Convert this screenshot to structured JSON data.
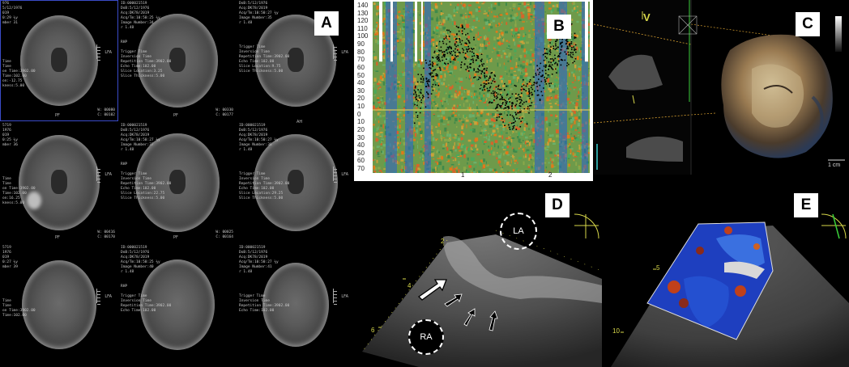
{
  "panels": {
    "a": {
      "badge": "A"
    },
    "b": {
      "badge": "B"
    },
    "c": {
      "badge": "C",
      "scale_label": "1 cm"
    },
    "d": {
      "badge": "D",
      "la_label": "LA",
      "ra_label": "RA"
    },
    "e": {
      "badge": "E"
    }
  },
  "mri": {
    "cells": [
      {
        "lines_left": [
          "976",
          "5/12/1976",
          "019",
          "0:29 ¼y",
          "mber 31",
          "",
          "",
          "",
          "",
          "",
          "",
          "",
          "Time",
          "Time",
          "on Time:3902.00",
          "Time:102.00",
          "on:-12.75",
          "kness:5.00"
        ],
        "lines_right": [
          "",
          "W: 00080",
          "C: 00102"
        ],
        "pf": "PF",
        "la": "LFA"
      },
      {
        "lines_left": [
          "ID:000021519",
          "DoB:5/12/1976",
          "Acq:DK78/2019",
          "Acq/Tm:10:50:25 ¼y",
          "Image Number:34",
          "r 1.48",
          "",
          "",
          "RHP",
          "",
          "Trigger Time",
          "Inversion Time",
          "Repetition Time:3902.00",
          "Echo Time:102.00",
          "Slice Location:3.25",
          "Slice Thickness:5.00"
        ],
        "lines_right": [
          "W: 00330",
          "C: 00177"
        ],
        "pf": "PF",
        "la": ""
      },
      {
        "lines_left": [
          "DoB:5/12/1976",
          "Acq:DK78/2019",
          "Acq/Tm:10:50:27 ¼y",
          "Image Number:35",
          "r 1.48",
          "",
          "",
          "",
          "",
          "Trigger Time",
          "Inversion Time",
          "Repetition Time:3902.00",
          "Echo Time:102.00",
          "Slice Location:9.75",
          "Slice Thickness:5.00"
        ],
        "lines_right": [],
        "pf": "",
        "la": "LFA"
      },
      {
        "lines_left": [
          "5719",
          "1976",
          "019",
          "0:25 ¼y",
          "mber 36",
          "",
          "",
          "",
          "",
          "",
          "",
          "Time",
          "Time",
          "on Time:3902.00",
          "Time:102.00",
          "on:16.25",
          "kness:5.00"
        ],
        "lines_right": [
          "W: 00416",
          "C: 00170"
        ],
        "pf": "PF",
        "la": "LFA"
      },
      {
        "lines_left": [
          "ID:000021519",
          "DoB:5/12/1976",
          "Acq:DK78/2019",
          "Acq/Tm:10:50:27 ¼y",
          "Image Number:37",
          "r 1.48",
          "",
          "",
          "RHP",
          "",
          "Trigger Time",
          "Inversion Time",
          "Repetition Time:3902.00",
          "Echo Time:102.00",
          "Slice Location:22.75",
          "Slice Thickness:5.00"
        ],
        "lines_right": [
          "W: 00025",
          "C: 00164"
        ],
        "pf": "PF",
        "la": ""
      },
      {
        "lines_left": [
          "ID:000021519",
          "DoB:5/12/1976",
          "Acq:DK78/2019",
          "Acq/Tm:10:50:27 ¼y",
          "Image Number:38",
          "r 1.48",
          "",
          "",
          "",
          "",
          "Trigger Time",
          "Inversion Time",
          "Repetition Time:3902.00",
          "Echo Time:102.00",
          "Slice Location:29.25",
          "Slice Thickness:5.00"
        ],
        "lines_right": [],
        "pf": "",
        "la": "LFA"
      },
      {
        "lines_left": [
          "5719",
          "1976",
          "019",
          "0:27 ¼y",
          "mber 39",
          "",
          "",
          "",
          "",
          "",
          "",
          "Time",
          "Time",
          "on Time:3902.00",
          "Time:102.00"
        ],
        "lines_right": [],
        "pf": "",
        "la": "LFA"
      },
      {
        "lines_left": [
          "ID:000021519",
          "DoB:5/12/1976",
          "Acq:DK78/2019",
          "Acq/Tm:10:50:25 ¼y",
          "Image Number:40",
          "r 1.48",
          "",
          "",
          "RHP",
          "",
          "Trigger Time",
          "Inversion Time",
          "Repetition Time:3902.00",
          "Echo Time:102.00"
        ],
        "lines_right": [],
        "pf": "",
        "la": ""
      },
      {
        "lines_left": [
          "ID:000021519",
          "DoB:5/12/1976",
          "Acq:DK78/2019",
          "Acq/Tm:10:50:27 ¼y",
          "Image Number:41",
          "r 1.48",
          "",
          "",
          "",
          "",
          "Trigger Time",
          "Inversion Time",
          "Repetition Time:3902.00",
          "Echo Time:102.00"
        ],
        "lines_right": [],
        "pf": "",
        "la": "LFA"
      }
    ],
    "ap_label": "AH"
  },
  "doppler": {
    "y_ticks": [
      "140",
      "130",
      "120",
      "110",
      "100",
      "90",
      "80",
      "70",
      "60",
      "50",
      "40",
      "30",
      "20",
      "10",
      "0",
      "10",
      "20",
      "30",
      "40",
      "50",
      "60",
      "70"
    ],
    "x_ticks": [
      "1",
      "2"
    ]
  },
  "echo_c": {
    "v_label": "V"
  },
  "echo_d": {
    "depth_ticks": [
      "2",
      "4",
      "6"
    ]
  },
  "echo_e": {
    "depth_ticks": [
      "5",
      "10"
    ]
  },
  "colors": {
    "badge_bg": "#ffffff",
    "mri_select": "#3a4bc8",
    "doppler_green": "#4aa85a",
    "doppler_orange": "#e07a1a",
    "doppler_blue": "#2a5fd0",
    "echo_yellow": "#d8d84a"
  }
}
